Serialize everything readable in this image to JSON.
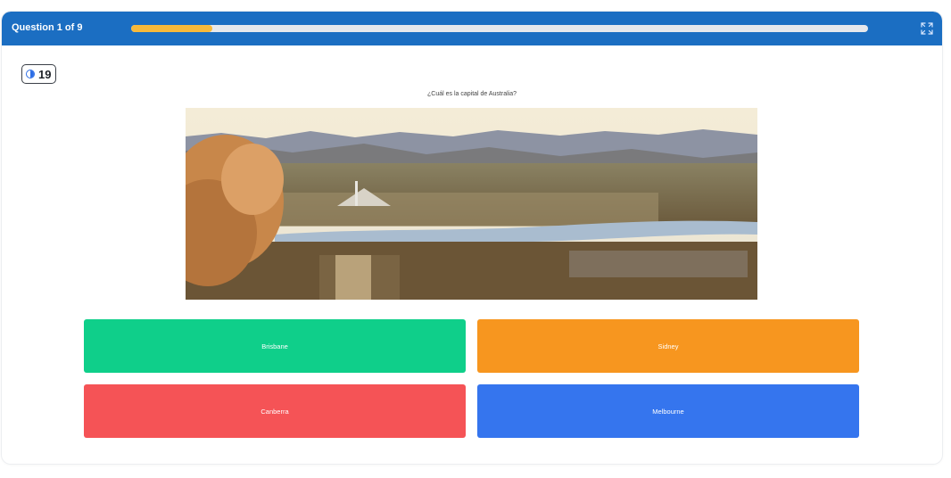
{
  "header": {
    "question_counter": "Question 1 of 9",
    "progress": 0.11,
    "colors": {
      "bar": "#1b6ec2",
      "progress_fill": "#f7b93a"
    }
  },
  "timer": {
    "value": "19",
    "icon": "timer-icon"
  },
  "question": {
    "text": "¿Cuál es la capital de Australia?",
    "image": "landscape photo of a city by a lake with mountains"
  },
  "answers": [
    {
      "label": "Brisbane",
      "color": "#0fcf8a"
    },
    {
      "label": "Sidney",
      "color": "#f7961f"
    },
    {
      "label": "Canberra",
      "color": "#f55356"
    },
    {
      "label": "Melbourne",
      "color": "#3575ee"
    }
  ],
  "icons": {
    "fullscreen": "expand-icon"
  }
}
